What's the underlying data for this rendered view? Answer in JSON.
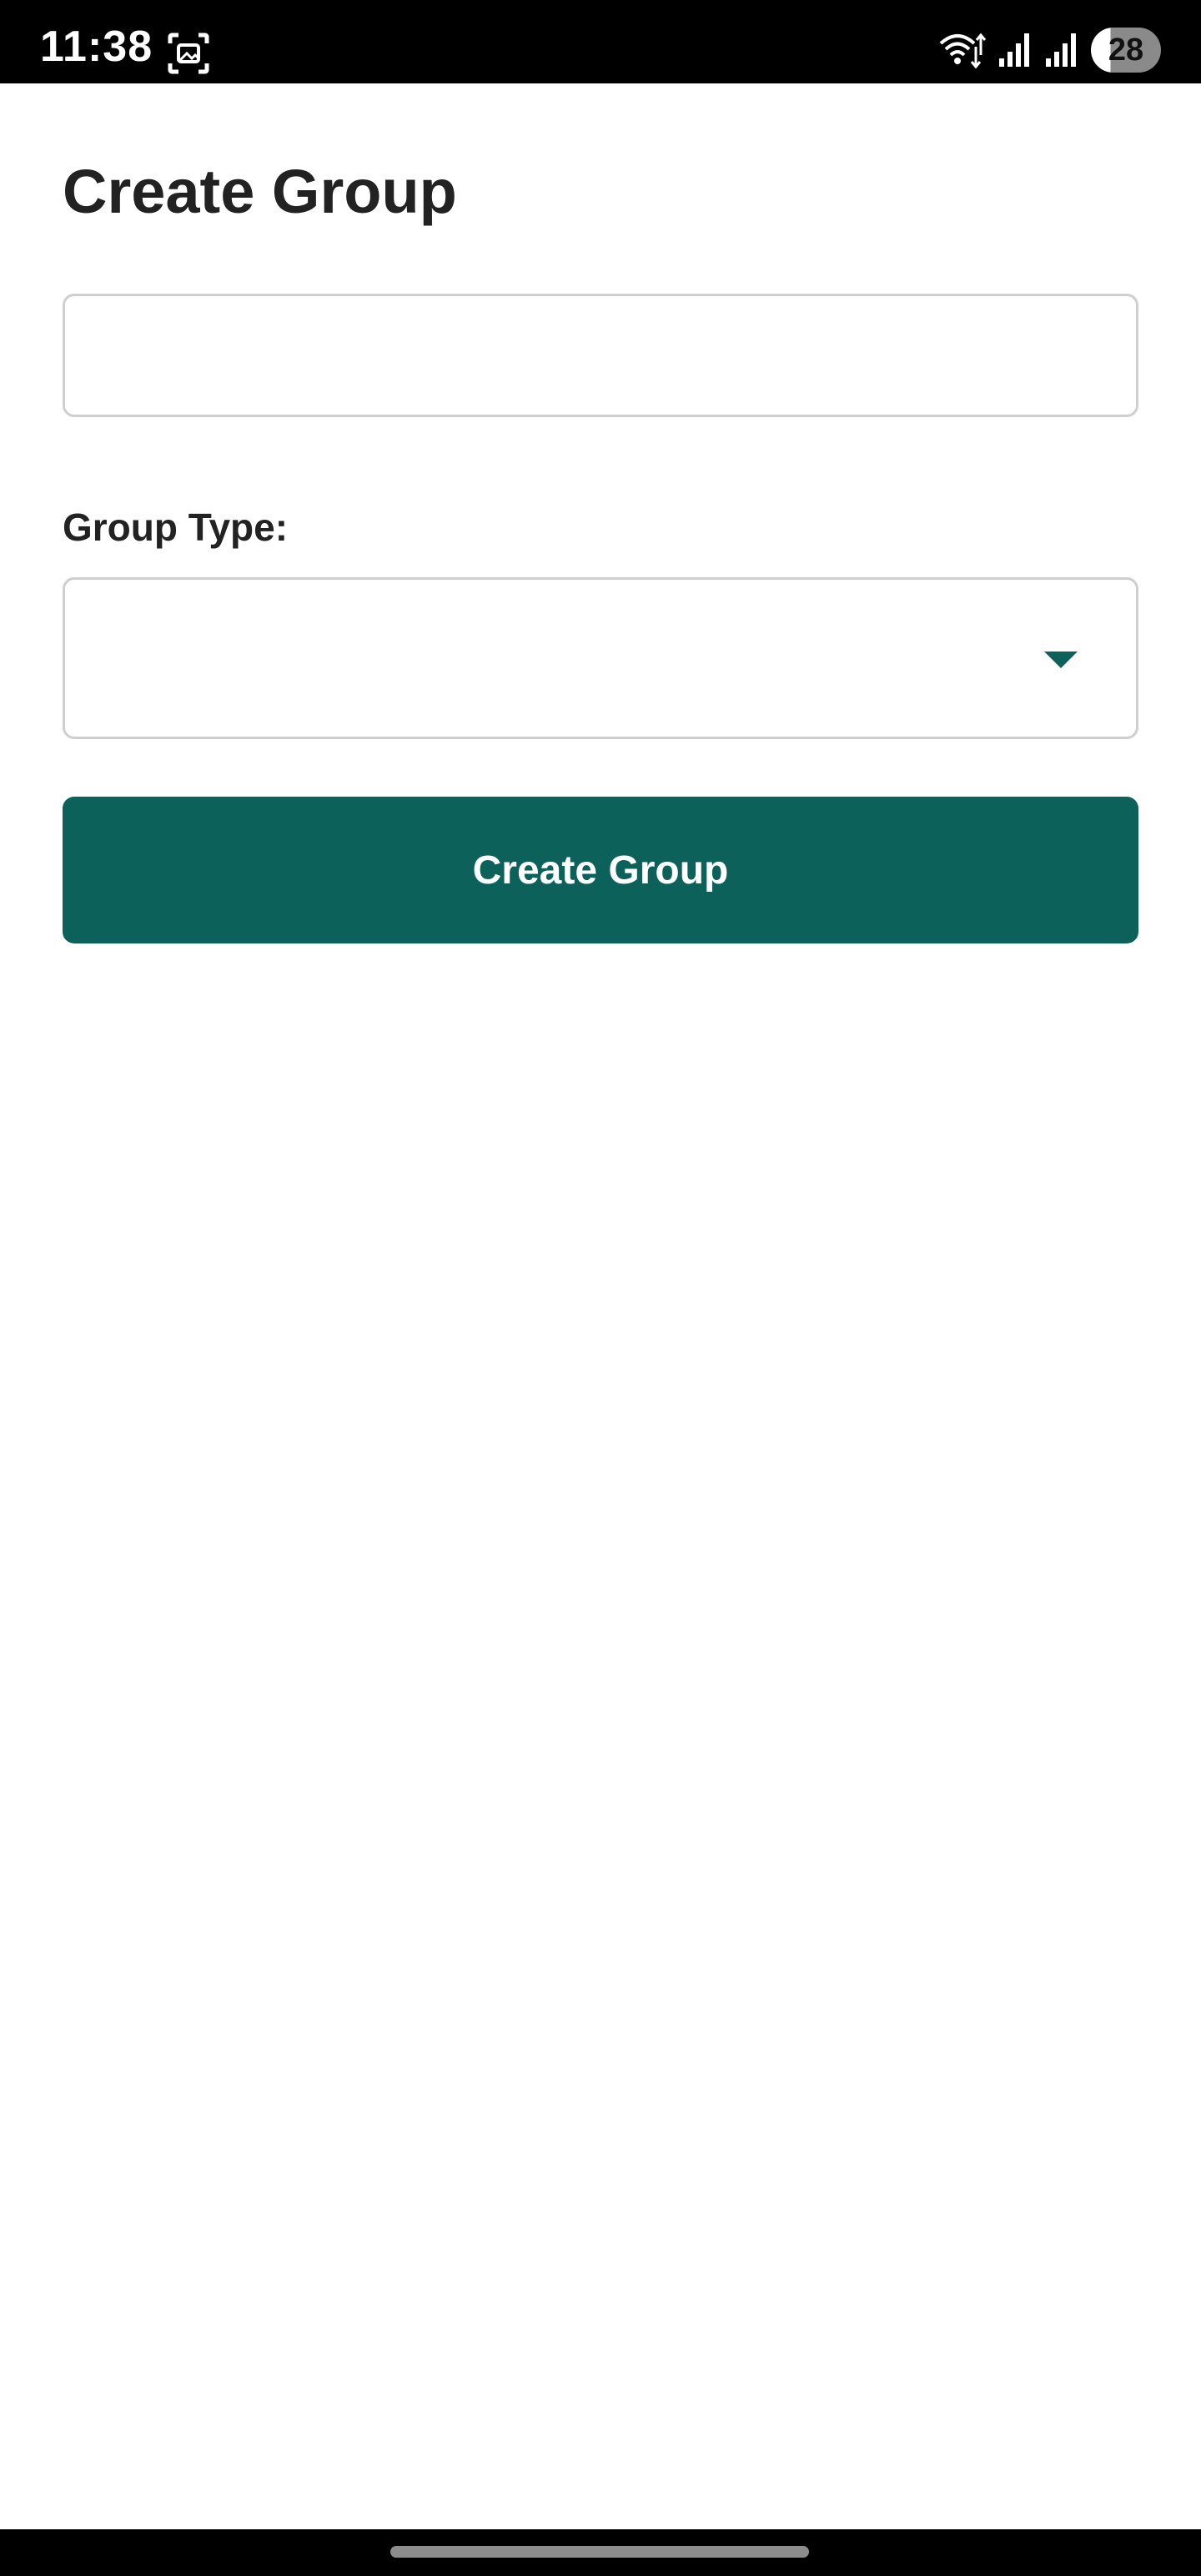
{
  "status_bar": {
    "time": "11:38",
    "battery_level": "28",
    "icons": [
      "screenshot-icon",
      "wifi-icon",
      "signal-icon",
      "signal-icon",
      "battery-icon"
    ]
  },
  "page": {
    "title": "Create Group"
  },
  "form": {
    "name_input": {
      "value": "",
      "placeholder": ""
    },
    "group_type_label": "Group Type:",
    "group_type_select": {
      "selected_value": ""
    },
    "submit_label": "Create Group"
  },
  "colors": {
    "accent": "#0c615a",
    "status_bar": "#000000",
    "text": "#222222",
    "border": "#cfcfcf"
  }
}
